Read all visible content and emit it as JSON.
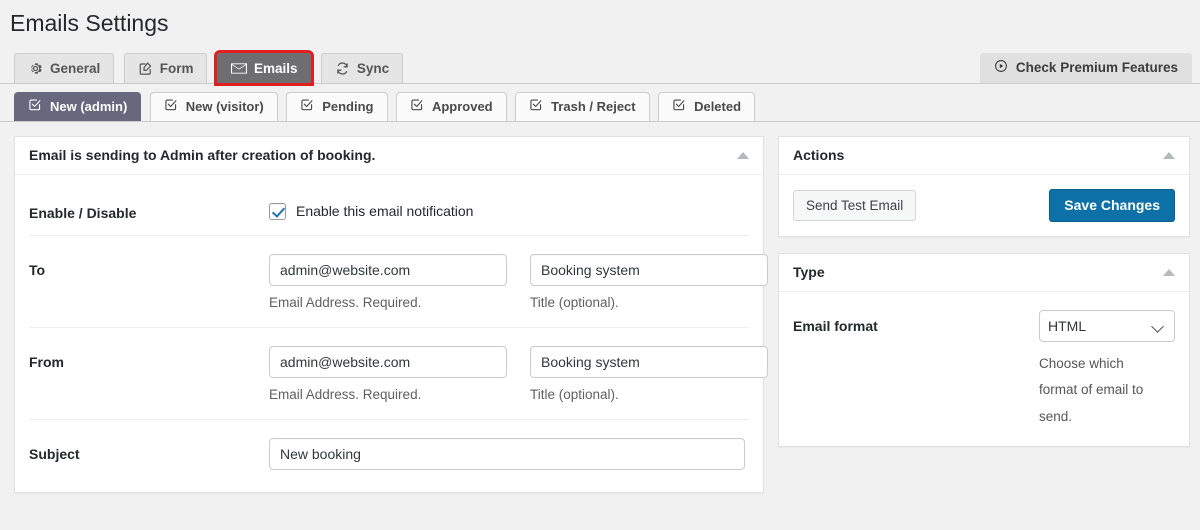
{
  "page": {
    "title": "Emails Settings"
  },
  "main_tabs": [
    {
      "label": "General",
      "icon": "gear-icon",
      "active": false,
      "highlighted": false
    },
    {
      "label": "Form",
      "icon": "edit-square-icon",
      "active": false,
      "highlighted": false
    },
    {
      "label": "Emails",
      "icon": "envelope-icon",
      "active": true,
      "highlighted": true
    },
    {
      "label": "Sync",
      "icon": "sync-icon",
      "active": false,
      "highlighted": false
    }
  ],
  "premium_button": {
    "label": "Check Premium Features",
    "icon": "circle-dot-icon"
  },
  "sub_tabs": [
    {
      "label": "New (admin)",
      "icon": "check-square-icon",
      "active": true
    },
    {
      "label": "New (visitor)",
      "icon": "check-square-icon",
      "active": false
    },
    {
      "label": "Pending",
      "icon": "check-square-icon",
      "active": false
    },
    {
      "label": "Approved",
      "icon": "check-square-icon",
      "active": false
    },
    {
      "label": "Trash / Reject",
      "icon": "check-square-icon",
      "active": false
    },
    {
      "label": "Deleted",
      "icon": "check-square-icon",
      "active": false
    }
  ],
  "email_panel": {
    "title": "Email is sending to Admin after creation of booking.",
    "rows": {
      "enable": {
        "label": "Enable / Disable",
        "checkbox_label": "Enable this email notification",
        "checked": true
      },
      "to": {
        "label": "To",
        "email_value": "admin@website.com",
        "email_hint": "Email Address. Required.",
        "title_value": "Booking system",
        "title_hint": "Title (optional)."
      },
      "from": {
        "label": "From",
        "email_value": "admin@website.com",
        "email_hint": "Email Address. Required.",
        "title_value": "Booking system",
        "title_hint": "Title (optional)."
      },
      "subject": {
        "label": "Subject",
        "value": "New booking"
      }
    }
  },
  "actions_panel": {
    "title": "Actions",
    "send_test_label": "Send Test Email",
    "save_label": "Save Changes"
  },
  "type_panel": {
    "title": "Type",
    "label": "Email format",
    "selected": "HTML",
    "options": [
      "HTML"
    ],
    "hint": "Choose which format of email to send."
  },
  "colors": {
    "accent_blue": "#0d71a8",
    "active_tab": "#6d6d72",
    "active_subtab": "#67677d",
    "highlight_red": "#e02020",
    "page_bg": "#f1f1f1"
  }
}
